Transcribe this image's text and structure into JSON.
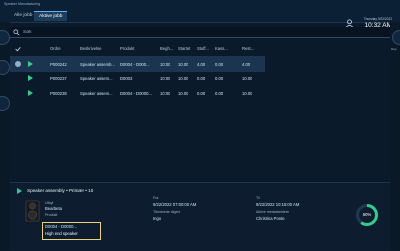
{
  "app": {
    "title": "Speaker Manufacturing"
  },
  "tabs": [
    {
      "label": "Alle jobb"
    },
    {
      "label": "Aktive jobb"
    }
  ],
  "datetime": {
    "date": "Thursday 9/22/2022",
    "time": "10:32 AM"
  },
  "side": {
    "right_label": "Rap"
  },
  "search": {
    "placeholder": "Søk"
  },
  "table": {
    "headers": [
      "Ordre",
      "Beskrivelse",
      "Produkt",
      "Begh...",
      "Startet",
      "Stuff...",
      "Kass...",
      "Rest..."
    ],
    "rows": [
      {
        "order": "P000242",
        "desc": "Speaker assemb...",
        "prod": "D0004 - D000...",
        "start": "10:00",
        "started": "10.00",
        "stuff": "4.00",
        "kas": "0.00",
        "rest": "4.00",
        "selected": true
      },
      {
        "order": "P000237",
        "desc": "Speaker assem...",
        "prod": "D0003",
        "start": "10:00",
        "started": "10.00",
        "stuff": "0.00",
        "kas": "0.00",
        "rest": "10.00",
        "selected": false
      },
      {
        "order": "P000239",
        "desc": "Speaker assem...",
        "prod": "D0004 - D0000...",
        "start": "10:00",
        "started": "10.00",
        "stuff": "0.00",
        "kas": "0.00",
        "rest": "10.00",
        "selected": false
      }
    ]
  },
  "details": {
    "group": "Speaker assembly  •  Primær  •  10",
    "col1": {
      "l1": "Utbyt",
      "v1": "Bearbeta",
      "l2": "Produkt",
      "v2": "D0004 - D0000...",
      "v3": "High end speaker"
    },
    "col2": {
      "l1": "Fra",
      "v1": "9/22/2022 07:00:00 AM",
      "l2": "Tilordnede digert",
      "v2": "Ingo"
    },
    "col3": {
      "l1": "Til",
      "v1": "9/22/2022 10:15:00 AM",
      "l2": "Aktive medarbeidere",
      "v2": "Christina Ponte"
    },
    "progress_percent": 60,
    "progress_label": "60%",
    "progress_color": "#2ecf8b"
  }
}
